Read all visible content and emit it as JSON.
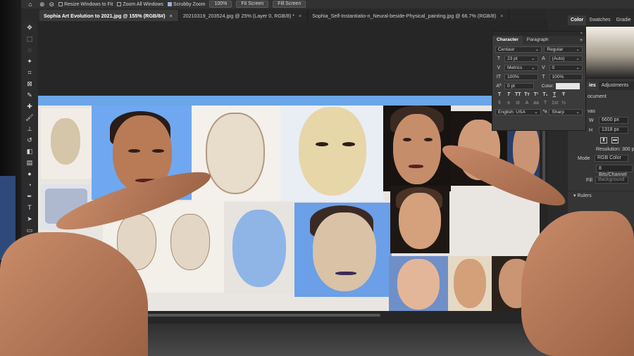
{
  "options_bar": {
    "home_icon": "home-icon",
    "resize_windows_label": "Resize Windows to Fit",
    "zoom_all_windows_label": "Zoom All Windows",
    "scrubby_zoom_label": "Scrubby Zoom",
    "zoom_value": "100%",
    "fit_screen_label": "Fit Screen",
    "fill_screen_label": "Fill Screen"
  },
  "tabs": [
    {
      "label": "Sophia Art Evolution to 2021.jpg @ 155% (RGB/8#)",
      "close": "×"
    },
    {
      "label": "20210319_203524.jpg @ 25% (Layer 0, RGB/8) *",
      "close": "×"
    },
    {
      "label": "Sophia_Self-Instantiatio-n_Neural-beside-Physical_painting.jpg @ 66.7% (RGB/8)",
      "close": "×"
    }
  ],
  "character_panel": {
    "tabs": [
      "Character",
      "Paragraph"
    ],
    "close_glyph": "×",
    "menu_glyph": "≡",
    "font_family": "Centaur",
    "font_style": "Regular",
    "font_size": "23 pt",
    "leading": "(Auto)",
    "kerning": "Metrics",
    "tracking": "0",
    "vertical_scale": "100%",
    "horizontal_scale": "100%",
    "baseline_shift": "0 pt",
    "color_label": "Color:",
    "style_glyphs": [
      "T",
      "T",
      "TT",
      "Tт",
      "T¹",
      "T₁",
      "T",
      "Ŧ"
    ],
    "opentype_glyphs": [
      "fi",
      "ɞ",
      "st",
      "A",
      "aa",
      "T",
      "1st",
      "½"
    ],
    "language": "English: USA",
    "antialias_label": "ªa",
    "antialias": "Sharp"
  },
  "right_panel": {
    "tabs": [
      "Color",
      "Swatches",
      "Gradie"
    ],
    "lower_tabs": [
      "ies",
      "Adjustments"
    ],
    "document_label": "ocument",
    "canvas_label": "vas",
    "width_label": "W",
    "width_value": "6600 px",
    "height_label": "H",
    "height_value": "1318 px",
    "resolution": "Resolution: 300 pi",
    "mode_label": "Mode",
    "mode_value": "RGB Color",
    "depth_value": "8 Bits/Channel",
    "fill_label": "Fill",
    "fill_value": "Background",
    "rulers_label": "Rulers"
  },
  "colors": {
    "panel_bg": "#3b3b3b",
    "canvas_bg": "#e9e6e2",
    "canvas_top": "#6aa6e8",
    "active_tab": "#3a3a3a"
  },
  "toolbar_icons": [
    "move-icon",
    "marquee-icon",
    "lasso-icon",
    "magic-wand-icon",
    "crop-icon",
    "frame-icon",
    "eyedropper-icon",
    "healing-icon",
    "brush-icon",
    "stamp-icon",
    "history-brush-icon",
    "eraser-icon",
    "gradient-icon",
    "blur-icon",
    "dodge-icon",
    "pen-icon",
    "type-icon",
    "path-select-icon",
    "shape-icon",
    "hand-icon"
  ]
}
